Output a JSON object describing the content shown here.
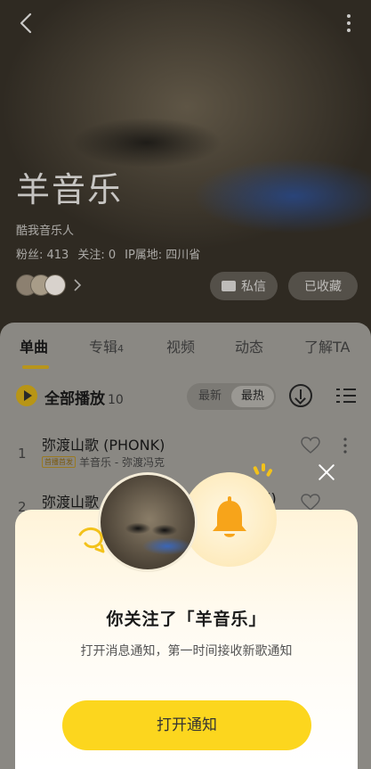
{
  "header": {
    "artist_name": "羊音乐",
    "tag": "酷我音乐人",
    "stats": {
      "fans": "粉丝: 413",
      "following": "关注: 0",
      "ip": "IP属地: 四川省"
    },
    "message_label": "私信",
    "favorite_label": "已收藏"
  },
  "tabs": [
    {
      "label": "单曲",
      "count": ""
    },
    {
      "label": "专辑",
      "count": "4"
    },
    {
      "label": "视频",
      "count": ""
    },
    {
      "label": "动态",
      "count": ""
    },
    {
      "label": "了解TA",
      "count": ""
    }
  ],
  "toolbar": {
    "play_all_label": "全部播放",
    "play_all_count": "10",
    "sort_latest": "最新",
    "sort_hot": "最热"
  },
  "songs": [
    {
      "index": "1",
      "title": "弥渡山歌 (PHONK)",
      "badge": "首播首发",
      "artist_album": "羊音乐 - 弥渡冯克"
    },
    {
      "index": "2",
      "title": "弥渡山歌",
      "title_tail": "l)",
      "badge": "",
      "artist_album": ""
    }
  ],
  "popup": {
    "title": "你关注了「羊音乐」",
    "description": "打开消息通知，第一时间接收新歌通知",
    "button_label": "打开通知",
    "icons": [
      "artist-avatar",
      "bell-icon",
      "close-icon"
    ]
  },
  "colors": {
    "accent_yellow": "#fcd61e",
    "popup_bg_top": "#fff4d9",
    "tab_underline": "#b8951c",
    "bell_orange": "#f7a41a"
  }
}
